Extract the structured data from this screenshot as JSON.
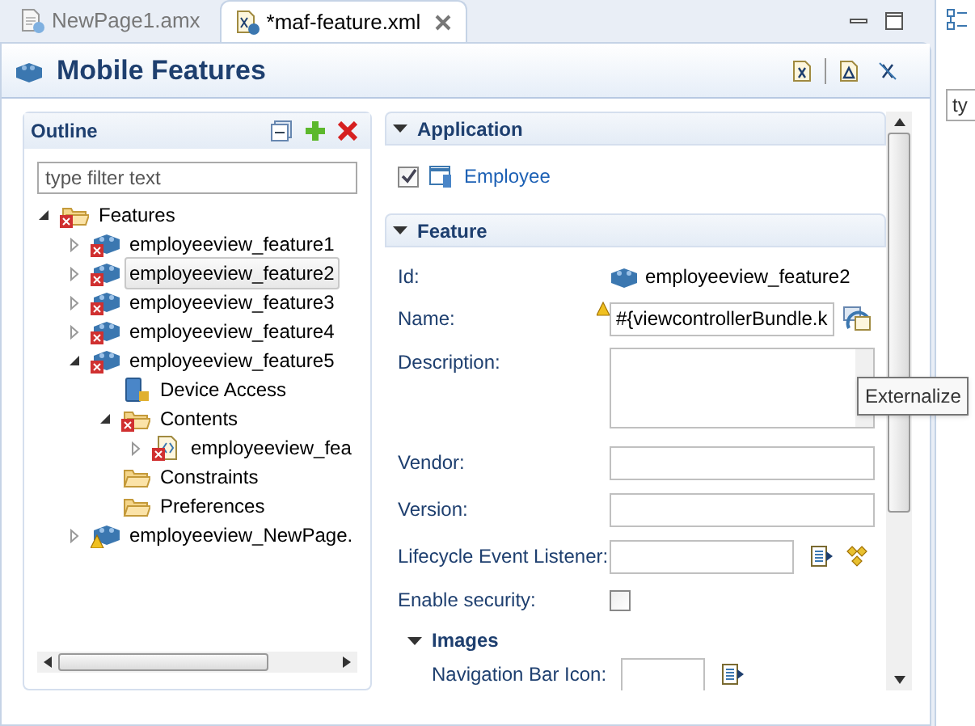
{
  "tabs": [
    {
      "label": "NewPage1.amx",
      "selected": false,
      "kind": "page"
    },
    {
      "label": "*maf-feature.xml",
      "selected": true,
      "kind": "xml"
    }
  ],
  "editor_title": "Mobile Features",
  "outline": {
    "title": "Outline",
    "filter": {
      "placeholder": "type filter text"
    },
    "tree": [
      {
        "label": "Features",
        "kind": "folder",
        "error": true,
        "expanded": true,
        "selected": false,
        "children": [
          {
            "label": "employeeview_feature1",
            "kind": "feature",
            "error": true,
            "expanded": false,
            "selected": false
          },
          {
            "label": "employeeview_feature2",
            "kind": "feature",
            "error": true,
            "expanded": false,
            "selected": true
          },
          {
            "label": "employeeview_feature3",
            "kind": "feature",
            "error": true,
            "expanded": false,
            "selected": false
          },
          {
            "label": "employeeview_feature4",
            "kind": "feature",
            "error": true,
            "expanded": false,
            "selected": false
          },
          {
            "label": "employeeview_feature5",
            "kind": "feature",
            "error": true,
            "expanded": true,
            "selected": false,
            "children": [
              {
                "label": "Device Access",
                "kind": "device",
                "selected": false
              },
              {
                "label": "Contents",
                "kind": "folder",
                "error": true,
                "expanded": true,
                "selected": false,
                "children": [
                  {
                    "label": "employeeview_fea",
                    "kind": "file",
                    "error": true,
                    "expanded": false,
                    "selected": false
                  }
                ]
              },
              {
                "label": "Constraints",
                "kind": "folder",
                "selected": false
              },
              {
                "label": "Preferences",
                "kind": "folder",
                "selected": false
              }
            ]
          },
          {
            "label": "employeeview_NewPage.",
            "kind": "feature",
            "warning": true,
            "expanded": false,
            "selected": false
          }
        ]
      }
    ]
  },
  "application": {
    "title": "Application",
    "expanded": true,
    "items": [
      {
        "label": "Employee",
        "checked": true
      }
    ]
  },
  "feature": {
    "title": "Feature",
    "expanded": true,
    "fields": [
      {
        "kind": "readonly",
        "label": "Id:",
        "value": "employeeview_feature2"
      },
      {
        "kind": "text",
        "label": "Name:",
        "value": "#{viewcontrollerBundle.k",
        "warning": true
      },
      {
        "kind": "textarea",
        "label": "Description:"
      },
      {
        "kind": "text",
        "label": "Vendor:"
      },
      {
        "kind": "text",
        "label": "Version:"
      },
      {
        "kind": "browse",
        "label": "Lifecycle Event Listener:"
      },
      {
        "kind": "checkbox",
        "label": "Enable security:",
        "checked": false
      }
    ]
  },
  "images": {
    "title": "Images",
    "expanded": true,
    "fields": [
      {
        "label": "Navigation Bar Icon:"
      }
    ]
  },
  "tooltip": "Externalize",
  "side_panel": {
    "filter": {
      "placeholder": "ty"
    }
  }
}
